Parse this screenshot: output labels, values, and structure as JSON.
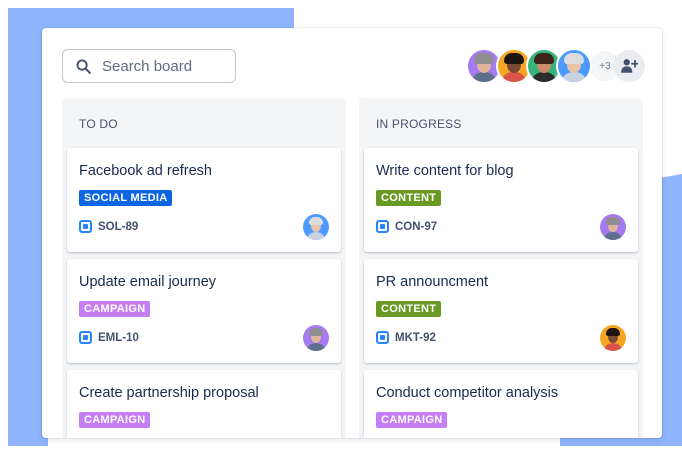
{
  "search": {
    "placeholder": "Search board",
    "icon": "search-icon"
  },
  "team": {
    "extra_count": "+3",
    "members": [
      {
        "bg": "#a77bf0",
        "skin": "#e0b49a",
        "hair": "#8e8e8e",
        "shirt": "#5c6f8a"
      },
      {
        "bg": "#f5a623",
        "skin": "#7a4a32",
        "hair": "#1e1410",
        "shirt": "#d8534a"
      },
      {
        "bg": "#36b37e",
        "skin": "#c98b68",
        "hair": "#3c2418",
        "shirt": "#2b2b2b"
      },
      {
        "bg": "#4c9aff",
        "skin": "#e8c4a8",
        "hair": "#dcdcdc",
        "shirt": "#c7d2e0"
      }
    ],
    "add_icon": "add-user-icon"
  },
  "colors": {
    "social_media": "#0c66e4",
    "campaign": "#c67ef5",
    "content": "#6a9a23",
    "issue_icon": "#2684ff"
  },
  "columns": [
    {
      "title": "TO DO",
      "cards": [
        {
          "title": "Facebook ad refresh",
          "tag": "SOCIAL MEDIA",
          "tag_color": "#0c66e4",
          "key": "SOL-89",
          "avatar": {
            "bg": "#4c9aff",
            "skin": "#e8c4a8",
            "hair": "#dcdcdc",
            "shirt": "#c7d2e0"
          }
        },
        {
          "title": "Update email journey",
          "tag": "CAMPAIGN",
          "tag_color": "#c67ef5",
          "key": "EML-10",
          "avatar": {
            "bg": "#a77bf0",
            "skin": "#e0b49a",
            "hair": "#8e8e8e",
            "shirt": "#5c6f8a"
          }
        },
        {
          "title": "Create partnership proposal",
          "tag": "CAMPAIGN",
          "tag_color": "#c67ef5"
        }
      ]
    },
    {
      "title": "IN PROGRESS",
      "cards": [
        {
          "title": "Write content for blog",
          "tag": "CONTENT",
          "tag_color": "#6a9a23",
          "key": "CON-97",
          "avatar": {
            "bg": "#a77bf0",
            "skin": "#e0b49a",
            "hair": "#8e8e8e",
            "shirt": "#5c6f8a"
          }
        },
        {
          "title": "PR announcment",
          "tag": "CONTENT",
          "tag_color": "#6a9a23",
          "key": "MKT-92",
          "avatar": {
            "bg": "#f5a623",
            "skin": "#7a4a32",
            "hair": "#1e1410",
            "shirt": "#d8534a"
          }
        },
        {
          "title": "Conduct competitor analysis",
          "tag": "CAMPAIGN",
          "tag_color": "#c67ef5"
        }
      ]
    }
  ]
}
